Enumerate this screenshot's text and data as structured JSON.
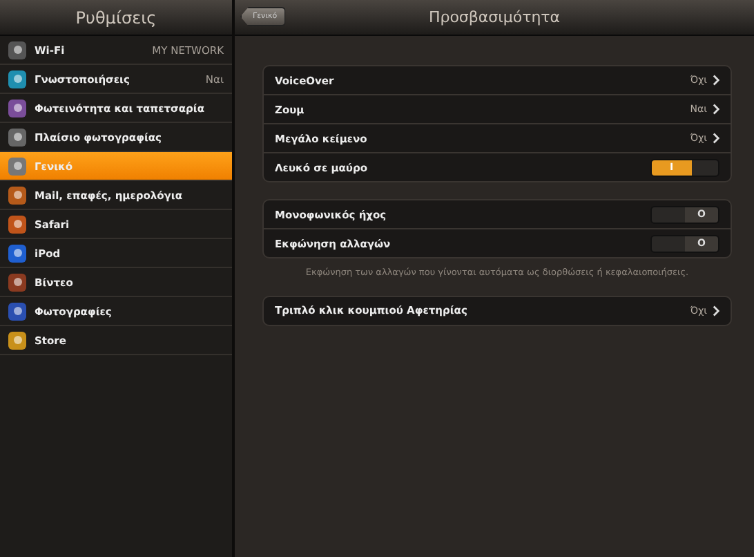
{
  "sidebar": {
    "title": "Ρυθμίσεις",
    "items": [
      {
        "label": "Wi-Fi",
        "value": "MY NETWORK",
        "selected": false
      },
      {
        "label": "Γνωστοποιήσεις",
        "value": "Ναι",
        "selected": false
      },
      {
        "label": "Φωτεινότητα και ταπετσαρία",
        "selected": false
      },
      {
        "label": "Πλαίσιο φωτογραφίας",
        "selected": false
      },
      {
        "label": "Γενικό",
        "selected": true
      },
      {
        "label": "Mail, επαφές, ημερολόγια",
        "selected": false
      },
      {
        "label": "Safari",
        "selected": false
      },
      {
        "label": "iPod",
        "selected": false
      },
      {
        "label": "Βίντεο",
        "selected": false
      },
      {
        "label": "Φωτογραφίες",
        "selected": false
      },
      {
        "label": "Store",
        "selected": false
      }
    ]
  },
  "header": {
    "back_button": "Γενικό",
    "title": "Προσβασιμότητα"
  },
  "groups": [
    {
      "rows": [
        {
          "kind": "detail",
          "label": "VoiceOver",
          "value": "Όχι"
        },
        {
          "kind": "detail",
          "label": "Ζουμ",
          "value": "Ναι"
        },
        {
          "kind": "detail",
          "label": "Μεγάλο κείμενο",
          "value": "Όχι"
        },
        {
          "kind": "switch",
          "label": "Λευκό σε μαύρο",
          "on": true,
          "glyph": "I"
        }
      ]
    },
    {
      "rows": [
        {
          "kind": "switch",
          "label": "Μονοφωνικός ήχος",
          "on": false,
          "glyph": "O"
        },
        {
          "kind": "switch",
          "label": "Εκφώνηση αλλαγών",
          "on": false,
          "glyph": "O"
        }
      ],
      "footer": "Εκφώνηση των αλλαγών που γίνονται αυτόματα ως διορθώσεις ή κεφαλαιοποιήσεις."
    },
    {
      "rows": [
        {
          "kind": "detail",
          "label": "Τριπλό κλικ κουμπιού Αφετηρίας",
          "value": "Όχι"
        }
      ]
    }
  ]
}
